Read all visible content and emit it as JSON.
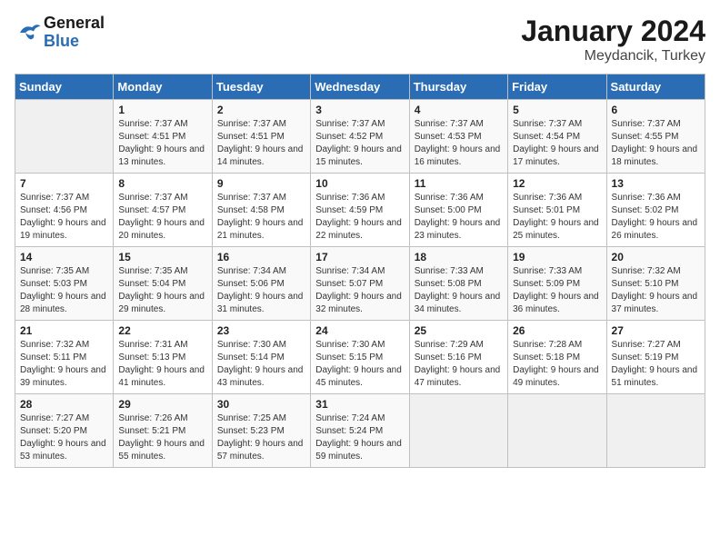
{
  "header": {
    "logo_general": "General",
    "logo_blue": "Blue",
    "month": "January 2024",
    "location": "Meydancik, Turkey"
  },
  "days_of_week": [
    "Sunday",
    "Monday",
    "Tuesday",
    "Wednesday",
    "Thursday",
    "Friday",
    "Saturday"
  ],
  "weeks": [
    [
      {
        "num": "",
        "sunrise": "",
        "sunset": "",
        "daylight": "",
        "empty": true
      },
      {
        "num": "1",
        "sunrise": "Sunrise: 7:37 AM",
        "sunset": "Sunset: 4:51 PM",
        "daylight": "Daylight: 9 hours and 13 minutes."
      },
      {
        "num": "2",
        "sunrise": "Sunrise: 7:37 AM",
        "sunset": "Sunset: 4:51 PM",
        "daylight": "Daylight: 9 hours and 14 minutes."
      },
      {
        "num": "3",
        "sunrise": "Sunrise: 7:37 AM",
        "sunset": "Sunset: 4:52 PM",
        "daylight": "Daylight: 9 hours and 15 minutes."
      },
      {
        "num": "4",
        "sunrise": "Sunrise: 7:37 AM",
        "sunset": "Sunset: 4:53 PM",
        "daylight": "Daylight: 9 hours and 16 minutes."
      },
      {
        "num": "5",
        "sunrise": "Sunrise: 7:37 AM",
        "sunset": "Sunset: 4:54 PM",
        "daylight": "Daylight: 9 hours and 17 minutes."
      },
      {
        "num": "6",
        "sunrise": "Sunrise: 7:37 AM",
        "sunset": "Sunset: 4:55 PM",
        "daylight": "Daylight: 9 hours and 18 minutes."
      }
    ],
    [
      {
        "num": "7",
        "sunrise": "Sunrise: 7:37 AM",
        "sunset": "Sunset: 4:56 PM",
        "daylight": "Daylight: 9 hours and 19 minutes."
      },
      {
        "num": "8",
        "sunrise": "Sunrise: 7:37 AM",
        "sunset": "Sunset: 4:57 PM",
        "daylight": "Daylight: 9 hours and 20 minutes."
      },
      {
        "num": "9",
        "sunrise": "Sunrise: 7:37 AM",
        "sunset": "Sunset: 4:58 PM",
        "daylight": "Daylight: 9 hours and 21 minutes."
      },
      {
        "num": "10",
        "sunrise": "Sunrise: 7:36 AM",
        "sunset": "Sunset: 4:59 PM",
        "daylight": "Daylight: 9 hours and 22 minutes."
      },
      {
        "num": "11",
        "sunrise": "Sunrise: 7:36 AM",
        "sunset": "Sunset: 5:00 PM",
        "daylight": "Daylight: 9 hours and 23 minutes."
      },
      {
        "num": "12",
        "sunrise": "Sunrise: 7:36 AM",
        "sunset": "Sunset: 5:01 PM",
        "daylight": "Daylight: 9 hours and 25 minutes."
      },
      {
        "num": "13",
        "sunrise": "Sunrise: 7:36 AM",
        "sunset": "Sunset: 5:02 PM",
        "daylight": "Daylight: 9 hours and 26 minutes."
      }
    ],
    [
      {
        "num": "14",
        "sunrise": "Sunrise: 7:35 AM",
        "sunset": "Sunset: 5:03 PM",
        "daylight": "Daylight: 9 hours and 28 minutes."
      },
      {
        "num": "15",
        "sunrise": "Sunrise: 7:35 AM",
        "sunset": "Sunset: 5:04 PM",
        "daylight": "Daylight: 9 hours and 29 minutes."
      },
      {
        "num": "16",
        "sunrise": "Sunrise: 7:34 AM",
        "sunset": "Sunset: 5:06 PM",
        "daylight": "Daylight: 9 hours and 31 minutes."
      },
      {
        "num": "17",
        "sunrise": "Sunrise: 7:34 AM",
        "sunset": "Sunset: 5:07 PM",
        "daylight": "Daylight: 9 hours and 32 minutes."
      },
      {
        "num": "18",
        "sunrise": "Sunrise: 7:33 AM",
        "sunset": "Sunset: 5:08 PM",
        "daylight": "Daylight: 9 hours and 34 minutes."
      },
      {
        "num": "19",
        "sunrise": "Sunrise: 7:33 AM",
        "sunset": "Sunset: 5:09 PM",
        "daylight": "Daylight: 9 hours and 36 minutes."
      },
      {
        "num": "20",
        "sunrise": "Sunrise: 7:32 AM",
        "sunset": "Sunset: 5:10 PM",
        "daylight": "Daylight: 9 hours and 37 minutes."
      }
    ],
    [
      {
        "num": "21",
        "sunrise": "Sunrise: 7:32 AM",
        "sunset": "Sunset: 5:11 PM",
        "daylight": "Daylight: 9 hours and 39 minutes."
      },
      {
        "num": "22",
        "sunrise": "Sunrise: 7:31 AM",
        "sunset": "Sunset: 5:13 PM",
        "daylight": "Daylight: 9 hours and 41 minutes."
      },
      {
        "num": "23",
        "sunrise": "Sunrise: 7:30 AM",
        "sunset": "Sunset: 5:14 PM",
        "daylight": "Daylight: 9 hours and 43 minutes."
      },
      {
        "num": "24",
        "sunrise": "Sunrise: 7:30 AM",
        "sunset": "Sunset: 5:15 PM",
        "daylight": "Daylight: 9 hours and 45 minutes."
      },
      {
        "num": "25",
        "sunrise": "Sunrise: 7:29 AM",
        "sunset": "Sunset: 5:16 PM",
        "daylight": "Daylight: 9 hours and 47 minutes."
      },
      {
        "num": "26",
        "sunrise": "Sunrise: 7:28 AM",
        "sunset": "Sunset: 5:18 PM",
        "daylight": "Daylight: 9 hours and 49 minutes."
      },
      {
        "num": "27",
        "sunrise": "Sunrise: 7:27 AM",
        "sunset": "Sunset: 5:19 PM",
        "daylight": "Daylight: 9 hours and 51 minutes."
      }
    ],
    [
      {
        "num": "28",
        "sunrise": "Sunrise: 7:27 AM",
        "sunset": "Sunset: 5:20 PM",
        "daylight": "Daylight: 9 hours and 53 minutes."
      },
      {
        "num": "29",
        "sunrise": "Sunrise: 7:26 AM",
        "sunset": "Sunset: 5:21 PM",
        "daylight": "Daylight: 9 hours and 55 minutes."
      },
      {
        "num": "30",
        "sunrise": "Sunrise: 7:25 AM",
        "sunset": "Sunset: 5:23 PM",
        "daylight": "Daylight: 9 hours and 57 minutes."
      },
      {
        "num": "31",
        "sunrise": "Sunrise: 7:24 AM",
        "sunset": "Sunset: 5:24 PM",
        "daylight": "Daylight: 9 hours and 59 minutes."
      },
      {
        "num": "",
        "sunrise": "",
        "sunset": "",
        "daylight": "",
        "empty": true
      },
      {
        "num": "",
        "sunrise": "",
        "sunset": "",
        "daylight": "",
        "empty": true
      },
      {
        "num": "",
        "sunrise": "",
        "sunset": "",
        "daylight": "",
        "empty": true
      }
    ]
  ]
}
